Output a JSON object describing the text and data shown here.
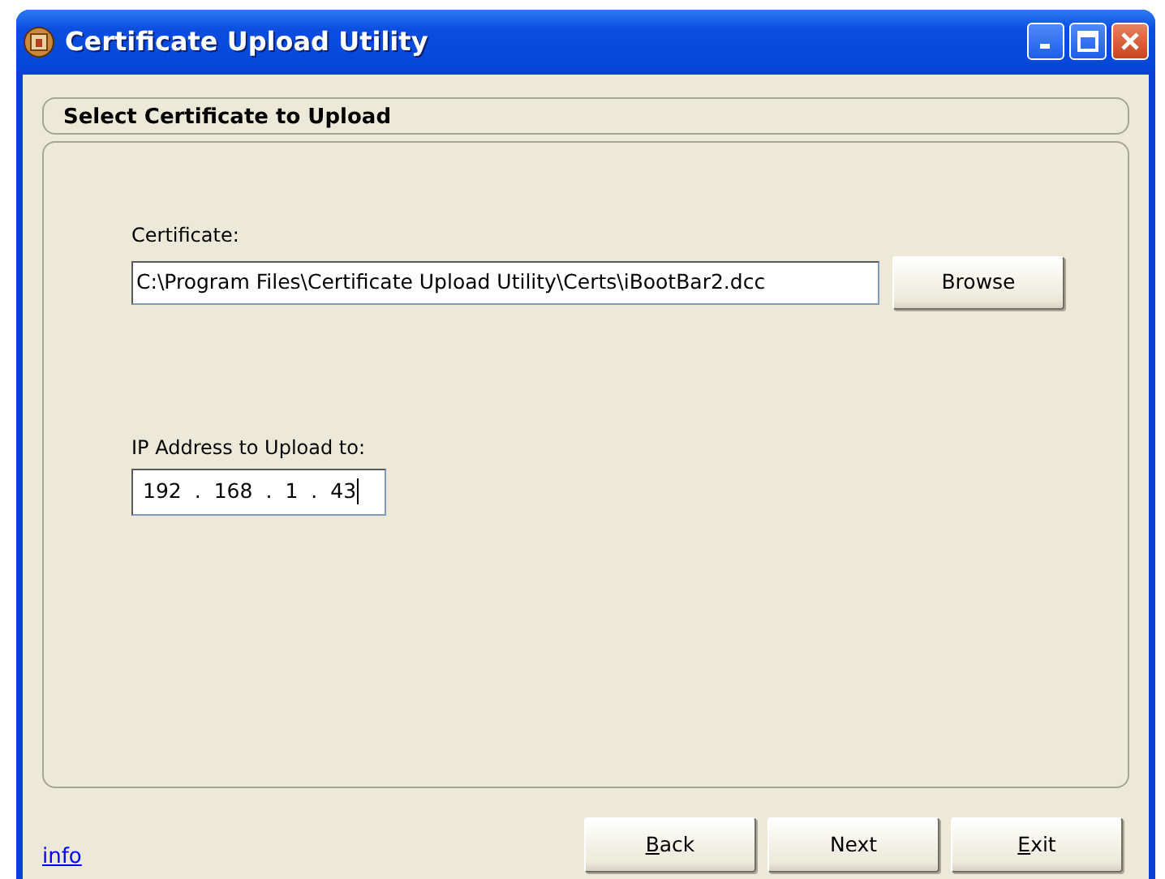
{
  "window": {
    "title": "Certificate Upload Utility"
  },
  "section": {
    "title": "Select Certificate to Upload"
  },
  "certificate": {
    "label": "Certificate:",
    "value": "C:\\Program Files\\Certificate Upload Utility\\Certs\\iBootBar2.dcc",
    "browse": "Browse"
  },
  "ip": {
    "label": "IP Address to Upload to:",
    "segments": [
      "192",
      ".",
      "168",
      ".",
      "1",
      ".",
      "43"
    ],
    "focused": true
  },
  "info_link": "info",
  "buttons": [
    {
      "accel": "B",
      "rest": "ack"
    },
    {
      "rest": "Next"
    },
    {
      "accel": "E",
      "rest": "xit"
    }
  ]
}
